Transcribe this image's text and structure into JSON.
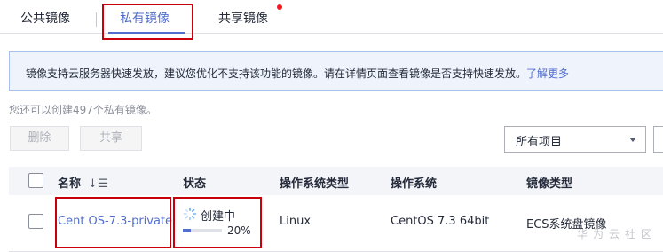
{
  "tabs": {
    "public": "公共镜像",
    "private": "私有镜像",
    "shared": "共享镜像"
  },
  "notice": {
    "text": "镜像支持云服务器快速发放，建议您优化不支持该功能的镜像。请在详情页面查看镜像是否支持快速发放。",
    "link": "了解更多"
  },
  "quota_text": "您还可以创建497个私有镜像。",
  "toolbar": {
    "delete_label": "删除",
    "share_label": "共享",
    "filter_value": "所有项目"
  },
  "table": {
    "columns": [
      "名称",
      "状态",
      "操作系统类型",
      "操作系统",
      "镜像类型"
    ],
    "rows": [
      {
        "name": "Cent OS-7.3-private",
        "status": "创建中",
        "progress_text": "20%",
        "progress": 0.2,
        "os_type": "Linux",
        "os": "CentOS 7.3 64bit",
        "image_type": "ECS系统盘镜像"
      }
    ]
  },
  "watermark": "华为云社区",
  "colors": {
    "accent": "#526ecc",
    "highlight_box": "#c7000b",
    "notification_dot": "#f3181d",
    "notice_bg": "#eef3fc"
  },
  "icons": [
    "sort-icon",
    "loading-spinner-icon",
    "chevron-down-icon",
    "notification-dot-icon"
  ]
}
